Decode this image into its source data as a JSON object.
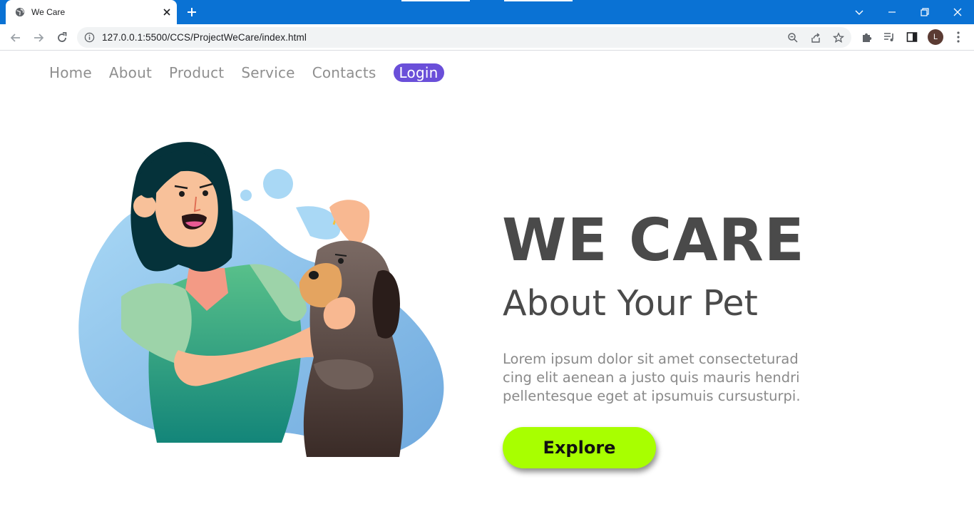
{
  "browser": {
    "tab_title": "We Care",
    "url": "127.0.0.1:5500/CCS/ProjectWeCare/index.html",
    "profile_initial": "L",
    "accent_color": "#0a72d4"
  },
  "nav": {
    "home": "Home",
    "about": "About",
    "product": "Product",
    "service": "Service",
    "contacts": "Contacts",
    "login": "Login",
    "login_color": "#6a4fd9"
  },
  "hero": {
    "title": "WE CARE",
    "subtitle": "About Your Pet",
    "text_lines": [
      "Lorem ipsum dolor sit amet consecteturad",
      "cing elit aenean a justo quis mauris hendri",
      "pellentesque eget at ipsumuis cursusturpi."
    ],
    "cta": "Explore",
    "cta_color": "#a8ff00"
  },
  "icons": {
    "tab_favicon": "globe-icon",
    "tab_close": "close-icon",
    "new_tab": "plus-icon",
    "back": "arrow-left-icon",
    "forward": "arrow-right-icon",
    "reload": "reload-icon",
    "site_info": "info-icon",
    "zoom": "zoom-icon",
    "share": "share-icon",
    "bookmark": "star-icon",
    "extensions": "puzzle-icon",
    "media": "media-control-icon",
    "side_panel": "side-panel-icon",
    "menu": "kebab-menu-icon"
  }
}
